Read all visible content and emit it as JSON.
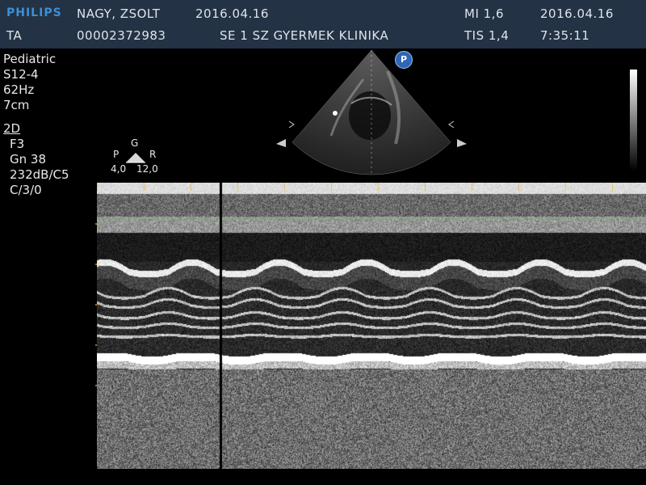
{
  "header": {
    "brand": "PHILIPS",
    "study_code": "TA",
    "patient_name": "NAGY, ZSOLT",
    "patient_id": "00002372983",
    "date_left": "2016.04.16",
    "institution": "SE 1 SZ GYERMEK KLINIKA",
    "mi": "MI 1,6",
    "tis": "TIS 1,4",
    "date_right": "2016.04.16",
    "time": "7:35:11"
  },
  "params": {
    "preset": "Pediatric",
    "probe": "S12-4",
    "frame_rate": "62Hz",
    "depth": "7cm",
    "mode": "2D",
    "freq": "F3",
    "gain": "Gn 38",
    "dynamic": "232dB/C5",
    "compress": "C/3/0"
  },
  "orientation": {
    "g": "G",
    "p": "P",
    "r": "R",
    "v1": "4,0",
    "v2": "12,0"
  },
  "probe_badge": "P",
  "colors": {
    "header_bg": "#233244",
    "brand": "#3b8fd8",
    "accent_line": "#7fb07a",
    "tick": "#e0c060"
  },
  "icons": {
    "orientation_marker": "triangle-icon",
    "probe_badge": "probe-p-icon"
  }
}
